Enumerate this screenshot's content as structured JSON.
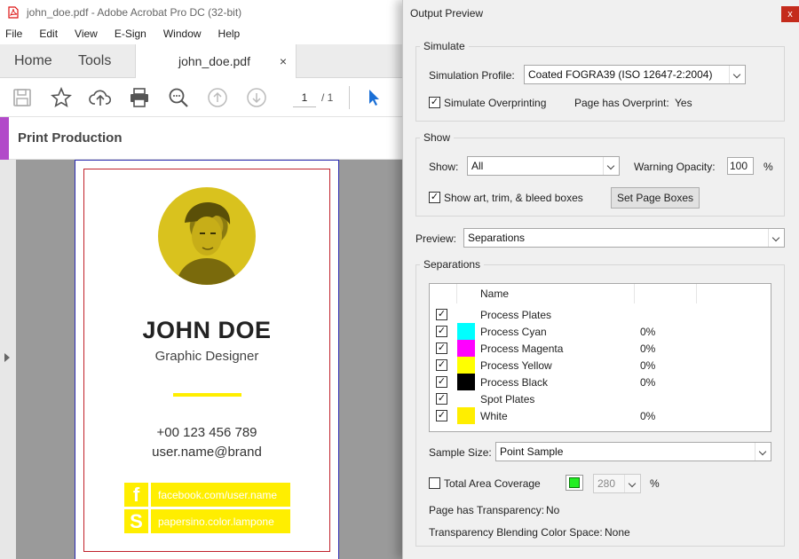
{
  "acrobat": {
    "window_title": "john_doe.pdf - Adobe Acrobat Pro DC (32-bit)",
    "menu": [
      "File",
      "Edit",
      "View",
      "E-Sign",
      "Window",
      "Help"
    ],
    "tabs": {
      "home": "Home",
      "tools": "Tools",
      "document": "john_doe.pdf",
      "close_glyph": "×"
    },
    "page_current": "1",
    "page_total": "/ 1",
    "panel_title": "Print Production",
    "card": {
      "name": "JOHN DOE",
      "title": "Graphic Designer",
      "phone": "+00 123 456 789",
      "email": "user.name@brand",
      "facebook_glyph": "f",
      "facebook": "facebook.com/user.name",
      "paper_glyph": "S",
      "paper": "papersino.color.lampone",
      "accent_color": "#ffee00"
    }
  },
  "dialog": {
    "title": "Output Preview",
    "close_glyph": "x",
    "simulate": {
      "legend": "Simulate",
      "profile_label": "Simulation Profile:",
      "profile_value": "Coated FOGRA39 (ISO 12647-2:2004)",
      "overprint_label": "Simulate Overprinting",
      "overprint_checked": "✓",
      "has_overprint_label": "Page has Overprint:",
      "has_overprint_value": "Yes"
    },
    "show": {
      "legend": "Show",
      "show_label": "Show:",
      "show_value": "All",
      "opacity_label": "Warning Opacity:",
      "opacity_value": "100",
      "opacity_unit": "%",
      "boxes_label": "Show art, trim, & bleed boxes",
      "boxes_checked": "✓",
      "set_boxes_button": "Set Page Boxes"
    },
    "preview": {
      "label": "Preview:",
      "value": "Separations"
    },
    "separations": {
      "legend": "Separations",
      "col_name": "Name",
      "rows": [
        {
          "checked": "✓",
          "name": "Process Plates",
          "color": "",
          "pct": ""
        },
        {
          "checked": "✓",
          "name": "Process Cyan",
          "color": "#00ffff",
          "pct": "0%"
        },
        {
          "checked": "✓",
          "name": "Process Magenta",
          "color": "#ff00ff",
          "pct": "0%"
        },
        {
          "checked": "✓",
          "name": "Process Yellow",
          "color": "#ffff00",
          "pct": "0%"
        },
        {
          "checked": "✓",
          "name": "Process Black",
          "color": "#000000",
          "pct": "0%"
        },
        {
          "checked": "✓",
          "name": "Spot Plates",
          "color": "",
          "pct": ""
        },
        {
          "checked": "✓",
          "name": "White",
          "color": "#ffee00",
          "pct": "0%"
        }
      ],
      "sample_label": "Sample Size:",
      "sample_value": "Point Sample",
      "tac_label": "Total Area Coverage",
      "tac_value": "280",
      "tac_unit": "%",
      "tac_swatch_color": "#22ee22",
      "transparency_label": "Page has Transparency:",
      "transparency_value": "No",
      "blend_label": "Transparency Blending Color Space:",
      "blend_value": "None"
    }
  }
}
